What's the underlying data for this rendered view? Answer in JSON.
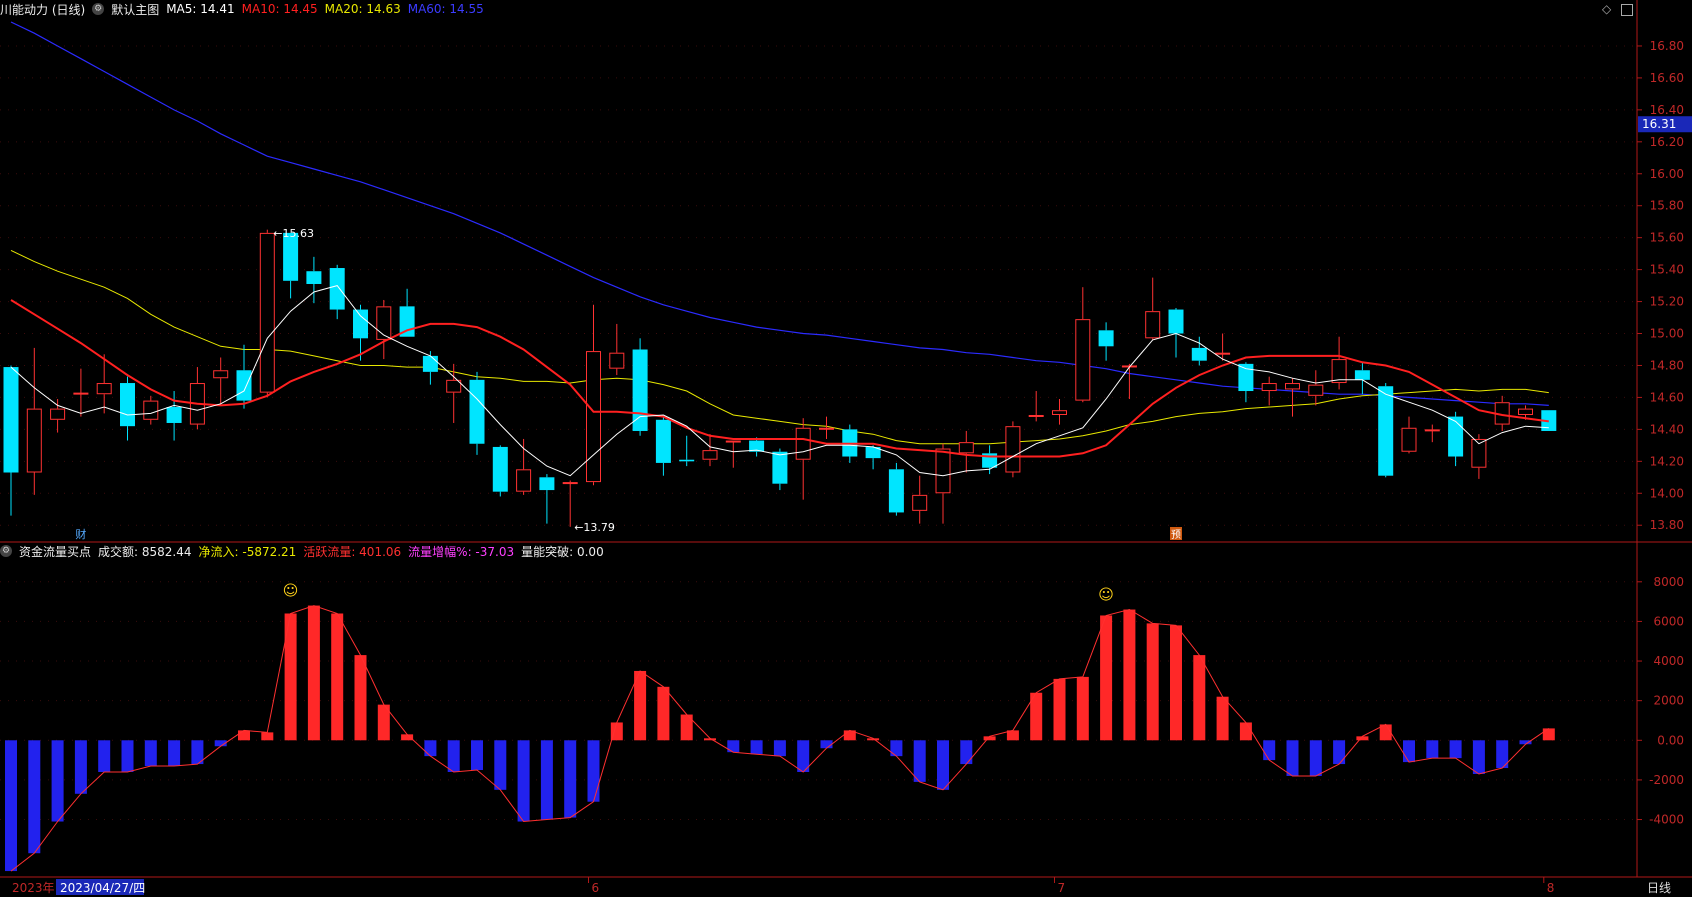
{
  "top_legend": {
    "title": "川能动力 (日线)",
    "template_label": "默认主图",
    "ma5": "MA5: 14.41",
    "ma10": "MA10: 14.45",
    "ma20": "MA20: 14.63",
    "ma60": "MA60: 14.55",
    "ma5_color": "#ffffff",
    "ma10_color": "#ff2020",
    "ma20_color": "#e8e800",
    "ma60_color": "#2b2bff"
  },
  "sub_legend": {
    "title": "资金流量买点",
    "volume": "成交额: 8582.44",
    "net_inflow": "净流入: -5872.21",
    "active_flow": "活跃流量: 401.06",
    "flow_growth": "流量增幅%: -37.03",
    "breakout": "量能突破: 0.00"
  },
  "chart_data": [
    {
      "type": "candlestick",
      "y_ticks": [
        "16.80",
        "16.60",
        "16.40",
        "16.20",
        "16.00",
        "15.80",
        "15.60",
        "15.40",
        "15.20",
        "15.00",
        "14.80",
        "14.60",
        "14.40",
        "14.20",
        "14.00",
        "13.80"
      ],
      "ylim": [
        13.72,
        16.95
      ],
      "current_price_label": "16.31",
      "high_label": "15.63",
      "low_label": "13.79",
      "markers": [
        "财",
        "预"
      ],
      "candles": [
        [
          14.79,
          14.13,
          14.8,
          13.86
        ],
        [
          14.13,
          14.53,
          14.91,
          13.99
        ],
        [
          14.46,
          14.53,
          14.59,
          14.38
        ],
        [
          14.63,
          14.63,
          14.78,
          14.48
        ],
        [
          14.62,
          14.69,
          14.87,
          14.5
        ],
        [
          14.69,
          14.42,
          14.73,
          14.33
        ],
        [
          14.46,
          14.58,
          14.61,
          14.43
        ],
        [
          14.54,
          14.44,
          14.64,
          14.33
        ],
        [
          14.43,
          14.69,
          14.79,
          14.4
        ],
        [
          14.72,
          14.77,
          14.85,
          14.55
        ],
        [
          14.77,
          14.58,
          14.93,
          14.53
        ],
        [
          14.63,
          15.63,
          15.65,
          14.6
        ],
        [
          15.63,
          15.33,
          15.5,
          15.22
        ],
        [
          15.39,
          15.31,
          15.48,
          15.19
        ],
        [
          15.41,
          15.15,
          15.43,
          15.09
        ],
        [
          15.15,
          14.97,
          15.18,
          14.83
        ],
        [
          14.96,
          15.17,
          15.21,
          14.84
        ],
        [
          15.17,
          14.98,
          15.28,
          14.98
        ],
        [
          14.86,
          14.76,
          14.89,
          14.68
        ],
        [
          14.63,
          14.71,
          14.81,
          14.44
        ],
        [
          14.71,
          14.31,
          14.76,
          14.24
        ],
        [
          14.29,
          14.01,
          14.3,
          13.98
        ],
        [
          14.01,
          14.15,
          14.34,
          13.99
        ],
        [
          14.1,
          14.02,
          14.12,
          13.81
        ],
        [
          14.06,
          14.07,
          14.08,
          13.79
        ],
        [
          14.07,
          14.89,
          15.18,
          14.05
        ],
        [
          14.78,
          14.88,
          15.06,
          14.74
        ],
        [
          14.9,
          14.39,
          14.97,
          14.36
        ],
        [
          14.46,
          14.19,
          14.48,
          14.11
        ],
        [
          14.21,
          14.2,
          14.36,
          14.17
        ],
        [
          14.21,
          14.27,
          14.37,
          14.17
        ],
        [
          14.32,
          14.33,
          14.33,
          14.16
        ],
        [
          14.33,
          14.26,
          14.35,
          14.23
        ],
        [
          14.26,
          14.06,
          14.28,
          14.02
        ],
        [
          14.21,
          14.41,
          14.47,
          13.96
        ],
        [
          14.41,
          14.41,
          14.48,
          14.34
        ],
        [
          14.4,
          14.23,
          14.43,
          14.19
        ],
        [
          14.29,
          14.22,
          14.3,
          14.15
        ],
        [
          14.15,
          13.88,
          14.19,
          13.86
        ],
        [
          13.89,
          13.99,
          14.11,
          13.81
        ],
        [
          14.0,
          14.28,
          14.31,
          13.81
        ],
        [
          14.25,
          14.32,
          14.39,
          14.13
        ],
        [
          14.25,
          14.16,
          14.3,
          14.12
        ],
        [
          14.13,
          14.42,
          14.45,
          14.1
        ],
        [
          14.48,
          14.49,
          14.64,
          14.45
        ],
        [
          14.49,
          14.52,
          14.59,
          14.43
        ],
        [
          14.58,
          15.09,
          15.29,
          14.57
        ],
        [
          15.02,
          14.92,
          15.07,
          14.83
        ],
        [
          14.8,
          14.8,
          14.81,
          14.59
        ],
        [
          14.97,
          15.14,
          15.35,
          14.96
        ],
        [
          15.15,
          15.0,
          15.16,
          14.85
        ],
        [
          14.91,
          14.83,
          14.98,
          14.8
        ],
        [
          14.88,
          14.88,
          15.0,
          14.83
        ],
        [
          14.81,
          14.64,
          14.82,
          14.57
        ],
        [
          14.64,
          14.69,
          14.73,
          14.55
        ],
        [
          14.65,
          14.69,
          14.72,
          14.48
        ],
        [
          14.61,
          14.68,
          14.77,
          14.55
        ],
        [
          14.69,
          14.84,
          14.98,
          14.65
        ],
        [
          14.77,
          14.71,
          14.82,
          14.62
        ],
        [
          14.67,
          14.11,
          14.69,
          14.1
        ],
        [
          14.26,
          14.41,
          14.48,
          14.25
        ],
        [
          14.39,
          14.4,
          14.43,
          14.32
        ],
        [
          14.48,
          14.23,
          14.51,
          14.17
        ],
        [
          14.16,
          14.34,
          14.37,
          14.09
        ],
        [
          14.43,
          14.57,
          14.61,
          14.39
        ],
        [
          14.49,
          14.53,
          14.55,
          14.46
        ],
        [
          14.52,
          14.39,
          14.52,
          14.39
        ]
      ],
      "ma5": [
        14.79,
        14.66,
        14.55,
        14.5,
        14.54,
        14.49,
        14.5,
        14.55,
        14.52,
        14.56,
        14.64,
        14.97,
        15.14,
        15.26,
        15.3,
        15.11,
        14.99,
        14.92,
        14.86,
        14.73,
        14.59,
        14.43,
        14.28,
        14.17,
        14.11,
        14.24,
        14.37,
        14.48,
        14.49,
        14.42,
        14.29,
        14.26,
        14.27,
        14.24,
        14.26,
        14.3,
        14.3,
        14.29,
        14.24,
        14.13,
        14.11,
        14.14,
        14.15,
        14.23,
        14.31,
        14.36,
        14.41,
        14.59,
        14.79,
        14.96,
        15.0,
        14.94,
        14.84,
        14.78,
        14.76,
        14.72,
        14.69,
        14.71,
        14.71,
        14.62,
        14.57,
        14.52,
        14.45,
        14.31,
        14.38,
        14.42,
        14.41
      ],
      "ma10": [
        15.21,
        15.12,
        15.03,
        14.94,
        14.84,
        14.74,
        14.65,
        14.58,
        14.56,
        14.55,
        14.56,
        14.61,
        14.7,
        14.76,
        14.81,
        14.87,
        14.95,
        15.02,
        15.06,
        15.06,
        15.04,
        14.98,
        14.9,
        14.79,
        14.68,
        14.51,
        14.51,
        14.5,
        14.48,
        14.41,
        14.36,
        14.34,
        14.34,
        14.34,
        14.34,
        14.31,
        14.31,
        14.31,
        14.28,
        14.27,
        14.26,
        14.24,
        14.23,
        14.23,
        14.23,
        14.23,
        14.25,
        14.3,
        14.43,
        14.56,
        14.66,
        14.74,
        14.8,
        14.85,
        14.86,
        14.86,
        14.86,
        14.86,
        14.82,
        14.8,
        14.76,
        14.68,
        14.6,
        14.52,
        14.49,
        14.47,
        14.45
      ],
      "ma20": [
        15.52,
        15.45,
        15.39,
        15.34,
        15.29,
        15.22,
        15.12,
        15.04,
        14.98,
        14.92,
        14.9,
        14.9,
        14.89,
        14.86,
        14.83,
        14.8,
        14.8,
        14.79,
        14.79,
        14.76,
        14.73,
        14.72,
        14.7,
        14.7,
        14.69,
        14.71,
        14.72,
        14.71,
        14.68,
        14.64,
        14.56,
        14.49,
        14.47,
        14.45,
        14.43,
        14.42,
        14.39,
        14.37,
        14.33,
        14.31,
        14.31,
        14.31,
        14.31,
        14.32,
        14.33,
        14.34,
        14.36,
        14.39,
        14.43,
        14.45,
        14.48,
        14.5,
        14.51,
        14.53,
        14.54,
        14.55,
        14.56,
        14.59,
        14.61,
        14.62,
        14.63,
        14.64,
        14.65,
        14.64,
        14.65,
        14.65,
        14.63
      ],
      "ma60": [
        16.95,
        16.88,
        16.8,
        16.72,
        16.64,
        16.56,
        16.48,
        16.4,
        16.33,
        16.25,
        16.18,
        16.11,
        16.07,
        16.03,
        15.99,
        15.95,
        15.9,
        15.85,
        15.8,
        15.75,
        15.69,
        15.63,
        15.56,
        15.49,
        15.42,
        15.35,
        15.29,
        15.23,
        15.18,
        15.14,
        15.1,
        15.07,
        15.04,
        15.02,
        15.0,
        14.99,
        14.97,
        14.95,
        14.93,
        14.91,
        14.9,
        14.88,
        14.87,
        14.85,
        14.83,
        14.82,
        14.8,
        14.78,
        14.75,
        14.73,
        14.71,
        14.69,
        14.67,
        14.66,
        14.65,
        14.64,
        14.63,
        14.62,
        14.62,
        14.61,
        14.6,
        14.59,
        14.58,
        14.57,
        14.56,
        14.56,
        14.55
      ]
    },
    {
      "type": "bar",
      "y_ticks": [
        "8000",
        "6000",
        "4000",
        "2000",
        "0.00",
        "-2000",
        "-4000"
      ],
      "ylim": [
        -6900,
        9100
      ],
      "values": [
        -6600,
        -5700,
        -4100,
        -2700,
        -1600,
        -1600,
        -1300,
        -1300,
        -1200,
        -300,
        500,
        400,
        6400,
        6800,
        6400,
        4300,
        1800,
        300,
        -800,
        -1600,
        -1500,
        -2500,
        -4100,
        -4000,
        -3900,
        -3100,
        900,
        3500,
        2700,
        1300,
        100,
        -600,
        -700,
        -800,
        -1600,
        -400,
        500,
        100,
        -800,
        -2100,
        -2500,
        -1200,
        200,
        500,
        2400,
        3100,
        3200,
        6300,
        6600,
        5900,
        5800,
        4300,
        2200,
        900,
        -1000,
        -1800,
        -1800,
        -1200,
        200,
        800,
        -1100,
        -900,
        -900,
        -1700,
        -1400,
        -200,
        600
      ],
      "smile_markers": [
        "☺",
        "☺"
      ]
    }
  ],
  "x_axis": {
    "year_label": "2023年",
    "date_cursor": "2023/04/27/四",
    "month_labels": [
      "6",
      "7",
      "8"
    ],
    "period_label": "日线"
  }
}
